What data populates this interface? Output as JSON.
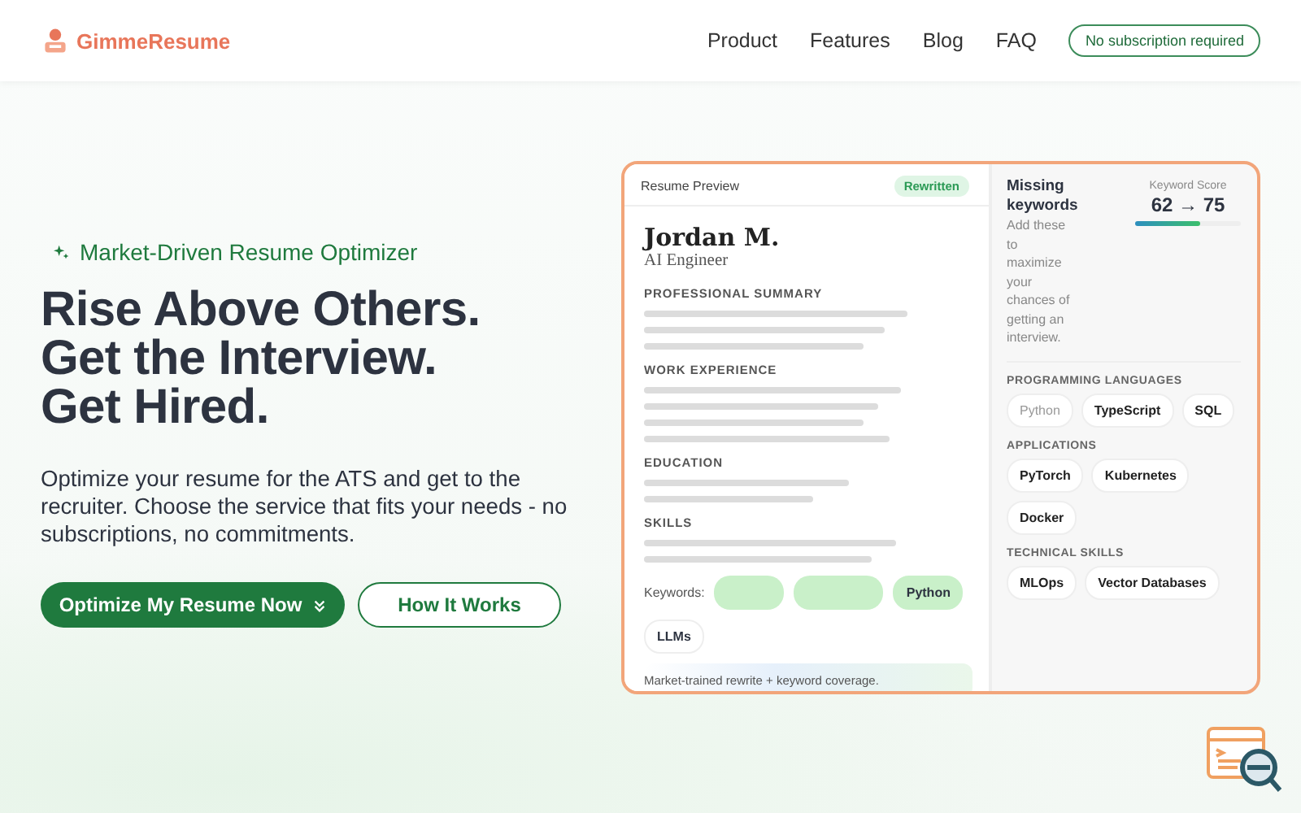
{
  "header": {
    "brand": "GimmeResume",
    "nav": [
      "Product",
      "Features",
      "Blog",
      "FAQ"
    ],
    "pill": "No subscription required"
  },
  "hero": {
    "eyebrow": "Market-Driven Resume Optimizer",
    "headline": [
      "Rise Above Others.",
      "Get the Interview.",
      "Get Hired."
    ],
    "text": "Optimize your resume for the ATS and get to the recruiter. Choose the service that fits your needs - no subscriptions, no commitments.",
    "buttons": [
      {
        "label": "Optimize My Resume Now",
        "kind": "primary"
      },
      {
        "label": "How It Works",
        "kind": "outline"
      }
    ]
  },
  "preview": {
    "title": "Resume Preview",
    "status": "Rewritten",
    "name": "Jordan M.",
    "role": "AI Engineer",
    "sections": [
      "PROFESSIONAL SUMMARY",
      "WORK EXPERIENCE",
      "EDUCATION",
      "SKILLS"
    ],
    "keywords_label": "Keywords:",
    "keywords": [
      {
        "kind": "blank"
      },
      {
        "kind": "blank"
      },
      {
        "kind": "tag",
        "label": "Python",
        "added": true
      },
      {
        "kind": "tag",
        "label": "LLMs",
        "added": false
      }
    ],
    "footnote": "Market-trained rewrite + keyword coverage."
  },
  "missing": {
    "title": "Missing keywords",
    "text": "Add these to maximize your chances of getting an interview.",
    "score_label": "Keyword Score",
    "score": "62 → 75",
    "level": 0.62,
    "groups": [
      {
        "title": "PROGRAMMING LANGUAGES",
        "chips": [
          {
            "label": "Python",
            "present": true
          },
          {
            "label": "TypeScript",
            "present": false
          },
          {
            "label": "SQL",
            "present": false
          }
        ]
      },
      {
        "title": "APPLICATIONS",
        "chips": [
          {
            "label": "PyTorch",
            "present": false
          },
          {
            "label": "Kubernetes",
            "present": false
          },
          {
            "label": "Docker",
            "present": false
          }
        ]
      },
      {
        "title": "TECHNICAL SKILLS",
        "chips": [
          {
            "label": "MLOps",
            "present": false
          },
          {
            "label": "Vector Databases",
            "present": false
          }
        ]
      }
    ]
  }
}
